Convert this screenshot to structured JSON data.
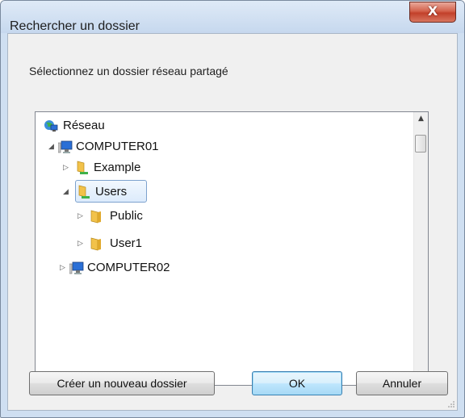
{
  "window": {
    "title": "Rechercher un dossier",
    "close_glyph": "X"
  },
  "instruction": "Sélectionnez un dossier réseau partagé",
  "tree": {
    "items": [
      {
        "label": "Réseau",
        "icon": "network-icon",
        "expander": ""
      },
      {
        "label": "COMPUTER01",
        "icon": "computer-icon",
        "expander": "◢"
      },
      {
        "label": "Example",
        "icon": "shared-folder-icon",
        "expander": "▷"
      },
      {
        "label": "Users",
        "icon": "shared-folder-icon",
        "expander": "◢",
        "selected": true
      },
      {
        "label": "Public",
        "icon": "folder-icon",
        "expander": "▷"
      },
      {
        "label": "User1",
        "icon": "folder-icon",
        "expander": "▷"
      },
      {
        "label": "COMPUTER02",
        "icon": "computer-icon",
        "expander": "▷"
      }
    ],
    "scroll_up": "▲",
    "scroll_down": "▼"
  },
  "buttons": {
    "new_folder": "Créer un nouveau dossier",
    "ok": "OK",
    "cancel": "Annuler"
  },
  "colors": {
    "selection_border": "#7da2ce",
    "folder": "#f2c24a",
    "monitor": "#2a6fd6"
  }
}
